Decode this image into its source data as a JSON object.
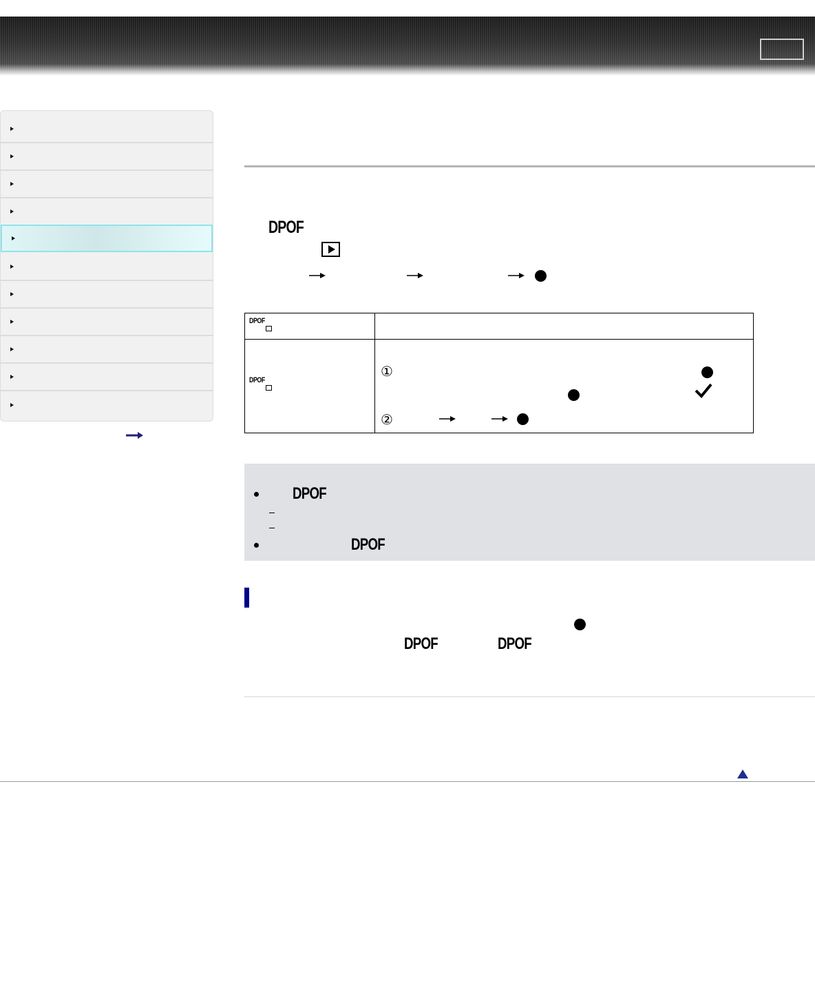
{
  "header": {
    "button_label": ""
  },
  "sidebar": {
    "items": [
      {
        "label": ""
      },
      {
        "label": ""
      },
      {
        "label": ""
      },
      {
        "label": ""
      },
      {
        "label": "",
        "active": true
      },
      {
        "label": ""
      },
      {
        "label": ""
      },
      {
        "label": ""
      },
      {
        "label": ""
      },
      {
        "label": ""
      },
      {
        "label": ""
      }
    ],
    "sitemap_link_icon": "right-arrow-icon"
  },
  "main": {
    "dpof_heading": "DPOF",
    "steps_icon": "playback-icon",
    "table": {
      "row1_icon_text": "DPOF",
      "row2_icon_text": "DPOF",
      "step1_marker": "①",
      "step2_marker": "②"
    },
    "note": {
      "dpof_1": "DPOF",
      "dash_1": "–",
      "dash_2": "–",
      "dpof_2": "DPOF"
    },
    "section": {
      "dpof_1": "DPOF",
      "dpof_2": "DPOF"
    }
  },
  "colors": {
    "accent_bar": "#00008b",
    "active_sidebar": "#8fe4ea",
    "note_bg": "#dfe1e5"
  }
}
